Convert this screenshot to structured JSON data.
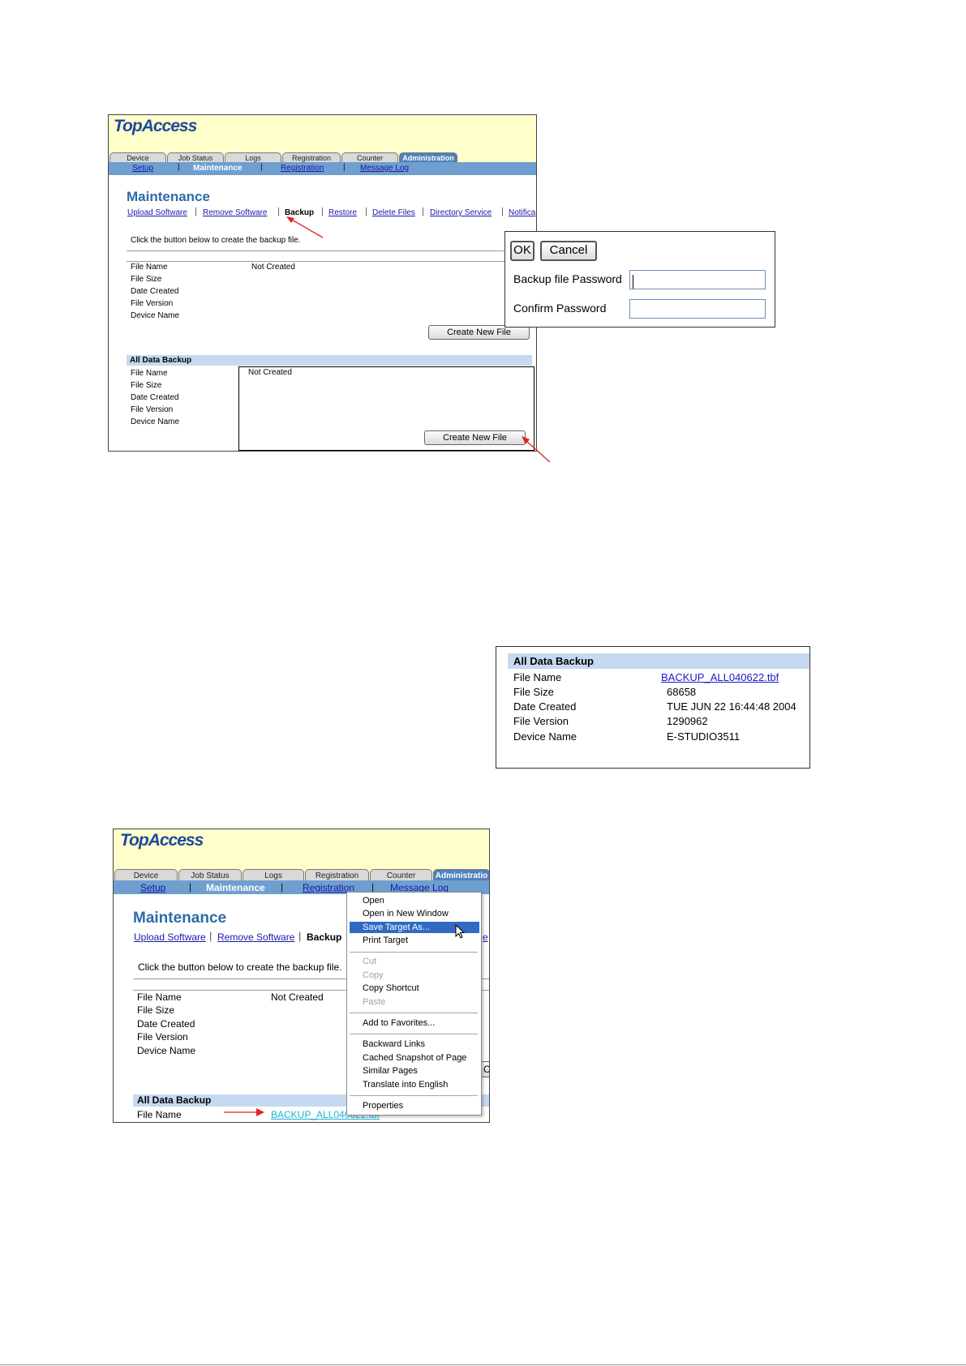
{
  "app": {
    "logo": "TopAccess",
    "tabs": [
      "Device",
      "Job Status",
      "Logs",
      "Registration",
      "Counter",
      "Administration"
    ],
    "tabs_bottom_last": "Administratio",
    "subnav": [
      "Setup",
      "Maintenance",
      "Registration",
      "Message Log"
    ],
    "page_title": "Maintenance",
    "maint_links": [
      "Upload Software",
      "Remove Software",
      "Backup",
      "Restore",
      "Delete Files",
      "Directory Service",
      "Notifica"
    ],
    "maint_links_partial_tail": "e",
    "instruction": "Click the button below to create the backup file.",
    "file_fields": [
      "File Name",
      "File Size",
      "Date Created",
      "File Version",
      "Device Name"
    ],
    "not_created": "Not Created",
    "create_button": "Create New File",
    "all_data_backup": "All Data Backup",
    "cut_button": "C",
    "colors": {
      "accent": "#4f81bd",
      "nav_bar": "#6f9fcf",
      "section": "#c5d9f1",
      "header_bg": "#ffffcc",
      "title": "#2e6aa8"
    }
  },
  "dialog": {
    "ok_label": "OK",
    "cancel_label": "Cancel",
    "password_label": "Backup file Password",
    "confirm_label": "Confirm Password"
  },
  "card": {
    "title": "All Data Backup",
    "rows": [
      {
        "label": "File Name",
        "value": "BACKUP_ALL040622.tbf"
      },
      {
        "label": "File Size",
        "value": "68658"
      },
      {
        "label": "Date Created",
        "value": "TUE JUN 22 16:44:48 2004"
      },
      {
        "label": "File Version",
        "value": "1290962"
      },
      {
        "label": "Device Name",
        "value": "E-STUDIO3511"
      }
    ]
  },
  "bottom": {
    "file_link": "BACKUP_ALL040622.tbf"
  },
  "context_menu": {
    "items": [
      {
        "label": "Open",
        "state": "normal"
      },
      {
        "label": "Open in New Window",
        "state": "normal"
      },
      {
        "label": "Save Target As...",
        "state": "highlighted"
      },
      {
        "label": "Print Target",
        "state": "normal"
      },
      {
        "label": "Cut",
        "state": "disabled"
      },
      {
        "label": "Copy",
        "state": "disabled"
      },
      {
        "label": "Copy Shortcut",
        "state": "normal"
      },
      {
        "label": "Paste",
        "state": "disabled"
      },
      {
        "label": "Add to Favorites...",
        "state": "normal"
      },
      {
        "label": "Backward Links",
        "state": "normal"
      },
      {
        "label": "Cached Snapshot of Page",
        "state": "normal"
      },
      {
        "label": "Similar Pages",
        "state": "normal"
      },
      {
        "label": "Translate into English",
        "state": "normal"
      },
      {
        "label": "Properties",
        "state": "normal"
      }
    ]
  }
}
